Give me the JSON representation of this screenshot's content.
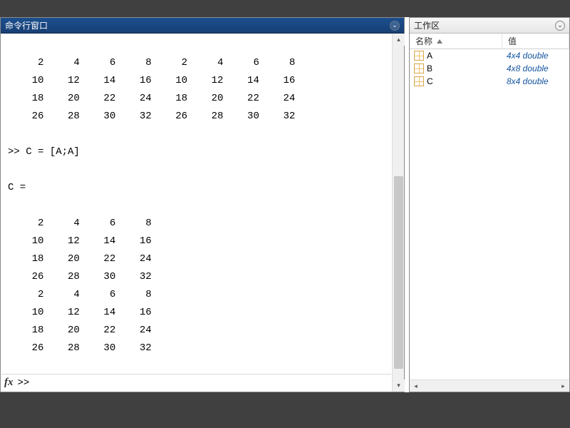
{
  "command_window": {
    "title": "命令行窗口",
    "output_lines": [
      "",
      "     2     4     6     8     2     4     6     8",
      "    10    12    14    16    10    12    14    16",
      "    18    20    22    24    18    20    22    24",
      "    26    28    30    32    26    28    30    32",
      "",
      ">> C = [A;A]",
      "",
      "C =",
      "",
      "     2     4     6     8",
      "    10    12    14    16",
      "    18    20    22    24",
      "    26    28    30    32",
      "     2     4     6     8",
      "    10    12    14    16",
      "    18    20    22    24",
      "    26    28    30    32",
      ""
    ],
    "prompt_symbol": ">>",
    "fx_label": "fx"
  },
  "workspace": {
    "title": "工作区",
    "columns": {
      "name": "名称",
      "value": "值"
    },
    "variables": [
      {
        "name": "A",
        "value": "4x4 double"
      },
      {
        "name": "B",
        "value": "4x8 double"
      },
      {
        "name": "C",
        "value": "8x4 double"
      }
    ]
  },
  "icons": {
    "dropdown": "⌄",
    "up": "▴",
    "down": "▾",
    "left": "◂",
    "right": "▸"
  }
}
